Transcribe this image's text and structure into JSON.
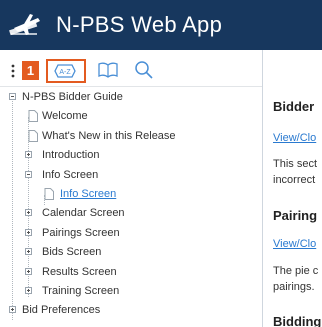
{
  "header": {
    "title": "N-PBS Web App",
    "logo_icon": "airplane-logo-icon",
    "background": "#17375e"
  },
  "toolbar": {
    "badge": "1",
    "sort_button_label": "A-Z",
    "accent": "#e35b20"
  },
  "toc": {
    "items": [
      {
        "label": "N-PBS Bidder Guide",
        "level": 0,
        "kind": "expanded"
      },
      {
        "label": "Welcome",
        "level": 1,
        "kind": "page"
      },
      {
        "label": "What's New in this Release",
        "level": 1,
        "kind": "page"
      },
      {
        "label": "Introduction",
        "level": 1,
        "kind": "collapsed"
      },
      {
        "label": "Info Screen",
        "level": 1,
        "kind": "expanded"
      },
      {
        "label": "Info Screen",
        "level": 2,
        "kind": "active-page"
      },
      {
        "label": "Calendar Screen",
        "level": 1,
        "kind": "collapsed"
      },
      {
        "label": "Pairings Screen",
        "level": 1,
        "kind": "collapsed"
      },
      {
        "label": "Bids Screen",
        "level": 1,
        "kind": "collapsed"
      },
      {
        "label": "Results Screen",
        "level": 1,
        "kind": "collapsed"
      },
      {
        "label": "Training Screen",
        "level": 1,
        "kind": "collapsed"
      },
      {
        "label": "Bid Preferences",
        "level": 0,
        "kind": "collapsed"
      }
    ]
  },
  "content": {
    "section1_title": "Bidder",
    "section1_link": "View/Clo",
    "section1_para_line1": "This sect",
    "section1_para_line2": "incorrect",
    "section2_title": "Pairing",
    "section2_link": "View/Clo",
    "section2_para_line1": "The pie c",
    "section2_para_line2": "pairings.",
    "section3_title": "Bidding"
  }
}
